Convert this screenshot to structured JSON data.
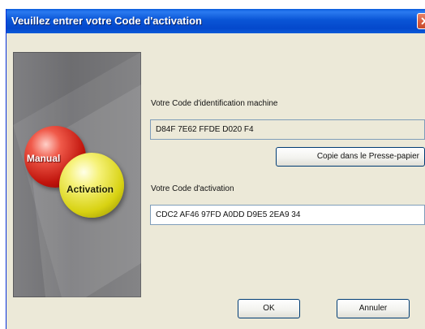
{
  "dialog": {
    "title": "Veuillez entrer votre Code d'activation",
    "close_glyph": "✕"
  },
  "side_panel": {
    "ball_red_text": "Manual",
    "ball_yellow_text": "Activation"
  },
  "machine": {
    "label": "Votre Code d'identification machine",
    "value": "D84F 7E62 FFDE D020 F4",
    "copy_button": "Copie dans le Presse-papier"
  },
  "activation": {
    "label": "Votre Code d'activation",
    "value": "CDC2 AF46 97FD A0DD D9E5 2EA9 34"
  },
  "buttons": {
    "ok": "OK",
    "cancel": "Annuler"
  },
  "colors": {
    "titlebar": "#0a55d6",
    "dialog_bg": "#ece9d8",
    "ball_red": "#c0140c",
    "ball_yellow": "#d8d212"
  }
}
